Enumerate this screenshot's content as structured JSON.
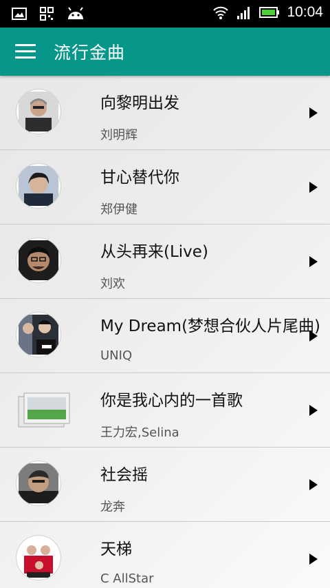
{
  "status_bar": {
    "left_icons": [
      "image-icon",
      "qr-code-icon",
      "android-icon"
    ],
    "right_icons": [
      "wifi-icon",
      "signal-icon",
      "battery-icon"
    ],
    "time": "10:04"
  },
  "app_bar": {
    "menu_icon": "hamburger-menu-icon",
    "title": "流行金曲",
    "color": "#07978a"
  },
  "songs": [
    {
      "title": "向黎明出发",
      "artist": "刘明辉"
    },
    {
      "title": "甘心替代你",
      "artist": "郑伊健"
    },
    {
      "title": "从头再来(Live)",
      "artist": "刘欢"
    },
    {
      "title": "My Dream(梦想合伙人片尾曲)",
      "artist": "UNIQ"
    },
    {
      "title": "你是我心内的一首歌",
      "artist": "王力宏,Selina"
    },
    {
      "title": "社会摇",
      "artist": "龙奔"
    },
    {
      "title": "天梯",
      "artist": "C AllStar"
    }
  ]
}
